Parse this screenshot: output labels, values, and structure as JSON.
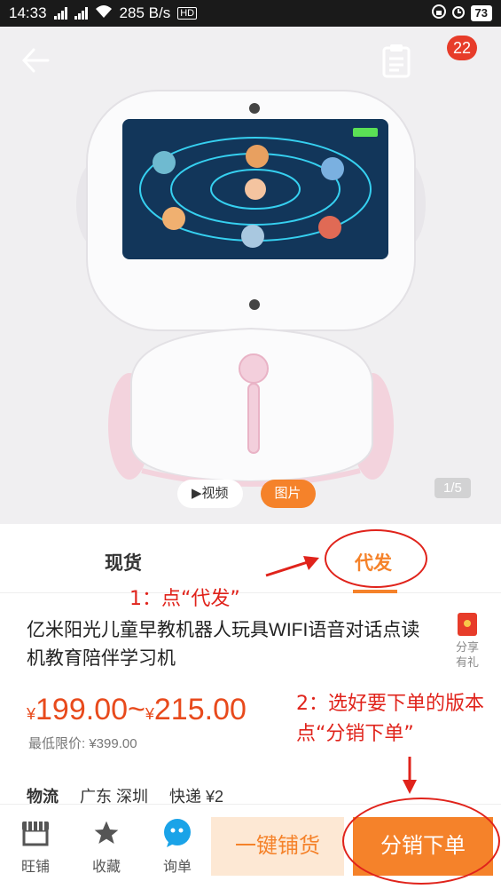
{
  "status_bar": {
    "time": "14:33",
    "net_4g": "4G",
    "net_2g": "2G",
    "speed": "285 B/s",
    "hd": "HD",
    "battery": "73"
  },
  "header": {
    "cart_count": "22"
  },
  "media": {
    "video_label": "▶视频",
    "photo_label": "图片",
    "page_indicator": "1/5"
  },
  "tabs": {
    "spot_label": "现货",
    "drop_label": "代发"
  },
  "annotations": {
    "step1": "1：点“代发”",
    "step2": "2：选好要下单的版本点“分销下单”"
  },
  "product": {
    "title": "亿米阳光儿童早教机器人玩具WIFI语音对话点读机教育陪伴学习机",
    "share_label": "分享有礼",
    "price_yen_1": "¥",
    "price_low": "199.00~",
    "price_yen_2": "¥",
    "price_high": "215.00",
    "min_price": "最低限价: ¥399.00"
  },
  "logistics": {
    "label": "物流",
    "location": "广东 深圳",
    "shipping": "快递 ¥2"
  },
  "bottom_bar": {
    "shop_label": "旺铺",
    "favorite_label": "收藏",
    "inquiry_label": "询单",
    "one_click_label": "一键铺货",
    "distribute_label": "分销下单"
  },
  "colors": {
    "accent": "#f5822a",
    "price": "#e84a1c",
    "annotation": "#e0231b",
    "badge": "#e73c2a"
  }
}
